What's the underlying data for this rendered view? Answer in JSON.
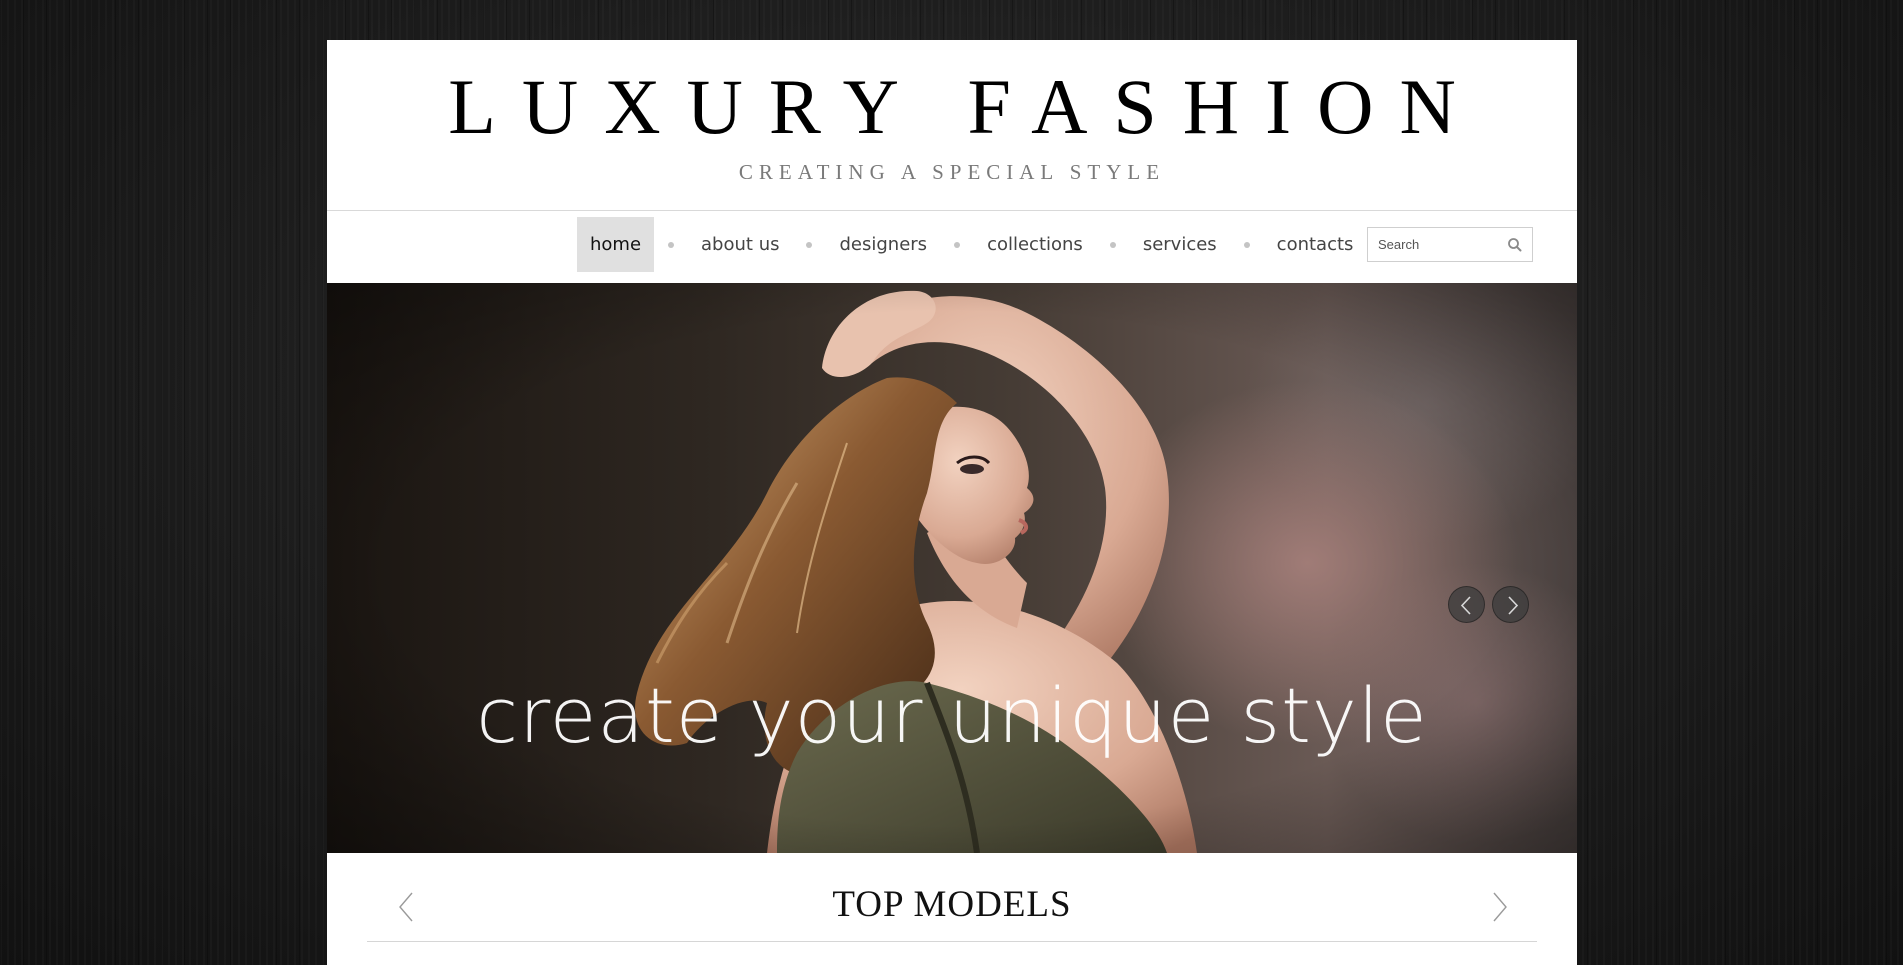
{
  "brand": {
    "title": "LUXURY FASHION",
    "tagline": "CREATING A SPECIAL STYLE"
  },
  "nav": {
    "items": [
      {
        "label": "home",
        "active": true
      },
      {
        "label": "about us",
        "active": false
      },
      {
        "label": "designers",
        "active": false
      },
      {
        "label": "collections",
        "active": false
      },
      {
        "label": "services",
        "active": false
      },
      {
        "label": "contacts",
        "active": false
      }
    ]
  },
  "search": {
    "placeholder": "Search",
    "icon": "magnifier-icon"
  },
  "slider": {
    "caption": "create your unique style",
    "prev_icon": "chevron-left-icon",
    "next_icon": "chevron-right-icon"
  },
  "section": {
    "title": "TOP MODELS",
    "prev_icon": "chevron-left-icon",
    "next_icon": "chevron-right-icon"
  },
  "colors": {
    "page_background": "#1c1c1c",
    "content_background": "#ffffff",
    "active_menu_background": "#e0e0e0",
    "menu_text": "#444444",
    "tagline_text": "#7a7a7a"
  }
}
